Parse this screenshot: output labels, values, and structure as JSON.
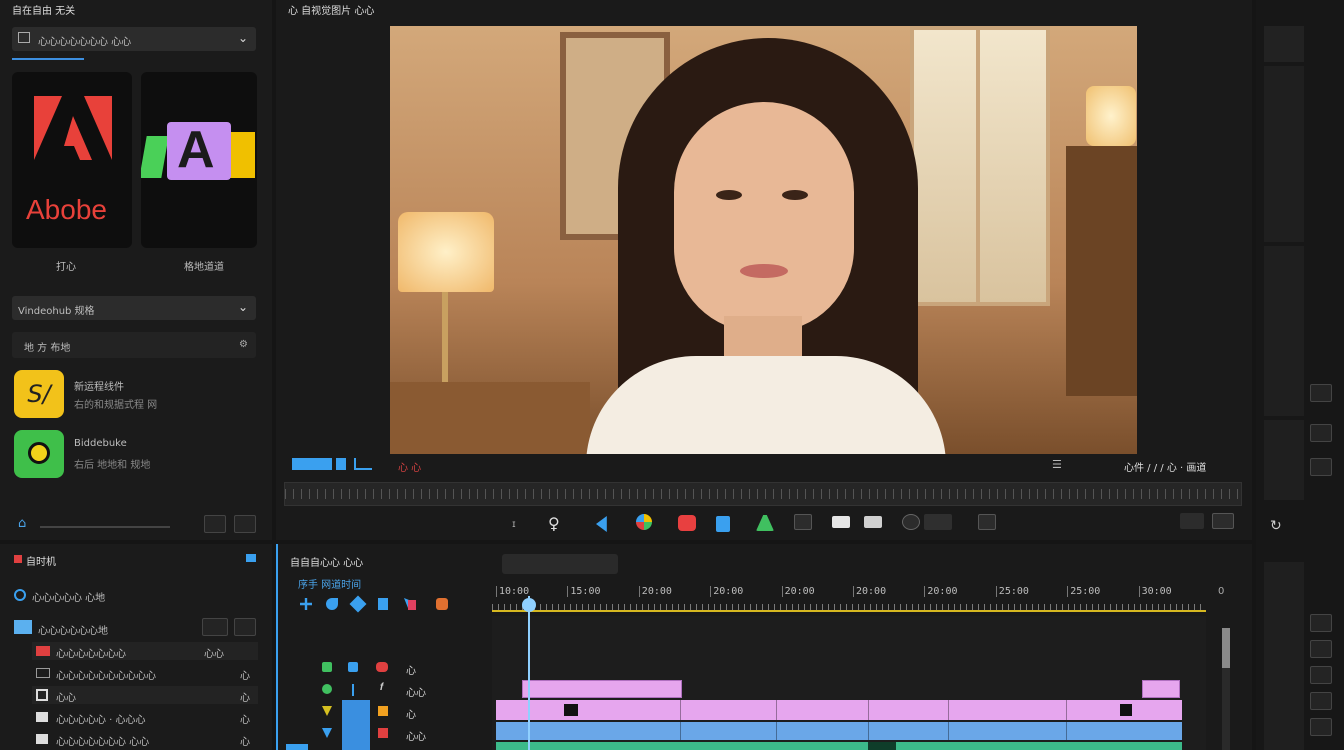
{
  "top_left_panel": {
    "title": "自在自由 无关",
    "dropdown_value": "心心心心心心心 心心",
    "app_tiles": [
      {
        "name": "Adobe",
        "label": "Abobe",
        "caption": "打心"
      },
      {
        "name": "LAs",
        "label": "A",
        "caption": "格地道道"
      }
    ],
    "second_dropdown": "Vindeohub 规格",
    "search_row": "地 方 布地",
    "list_items": [
      {
        "title": "新运程线件",
        "subtitle": "右的和规据式程 网"
      },
      {
        "title": "Biddebuke",
        "subtitle": "右后 地地和 规地"
      }
    ]
  },
  "monitor": {
    "title": "心 自视觉图片 心心",
    "transport_right": "心件 / / / 心 · 画道",
    "transport_mid": "心 心"
  },
  "project_panel": {
    "title": "自时机",
    "items": [
      {
        "label": "心心心心心 心地",
        "right": ""
      },
      {
        "label": "心心心心心心地",
        "right": ""
      },
      {
        "label": "心心心心心心心",
        "right": "心心"
      },
      {
        "label": "心心心心心心心心心心",
        "right": "心"
      },
      {
        "label": "心心",
        "right": "心"
      },
      {
        "label": "心心心心心 · 心心心",
        "right": "心"
      },
      {
        "label": "心心心心心心心 心心",
        "right": "心"
      }
    ]
  },
  "timeline": {
    "title": "自自自心心 心心",
    "subtitle": "序手 网道时间",
    "ruler_labels": [
      "10:00",
      "15:00",
      "20:00",
      "20:00",
      "20:00",
      "20:00",
      "20:00",
      "25:00",
      "25:00",
      "30:00"
    ],
    "track_labels": [
      "心",
      "心心",
      "心",
      "心心"
    ]
  },
  "colors": {
    "accent_blue": "#4aa3e8",
    "playhead": "#8fd0ff",
    "ruler_yellow": "#d6b820",
    "clip_pink": "#e6a6ee",
    "clip_blue": "#6aa7e8",
    "clip_green": "#3cba8a"
  }
}
